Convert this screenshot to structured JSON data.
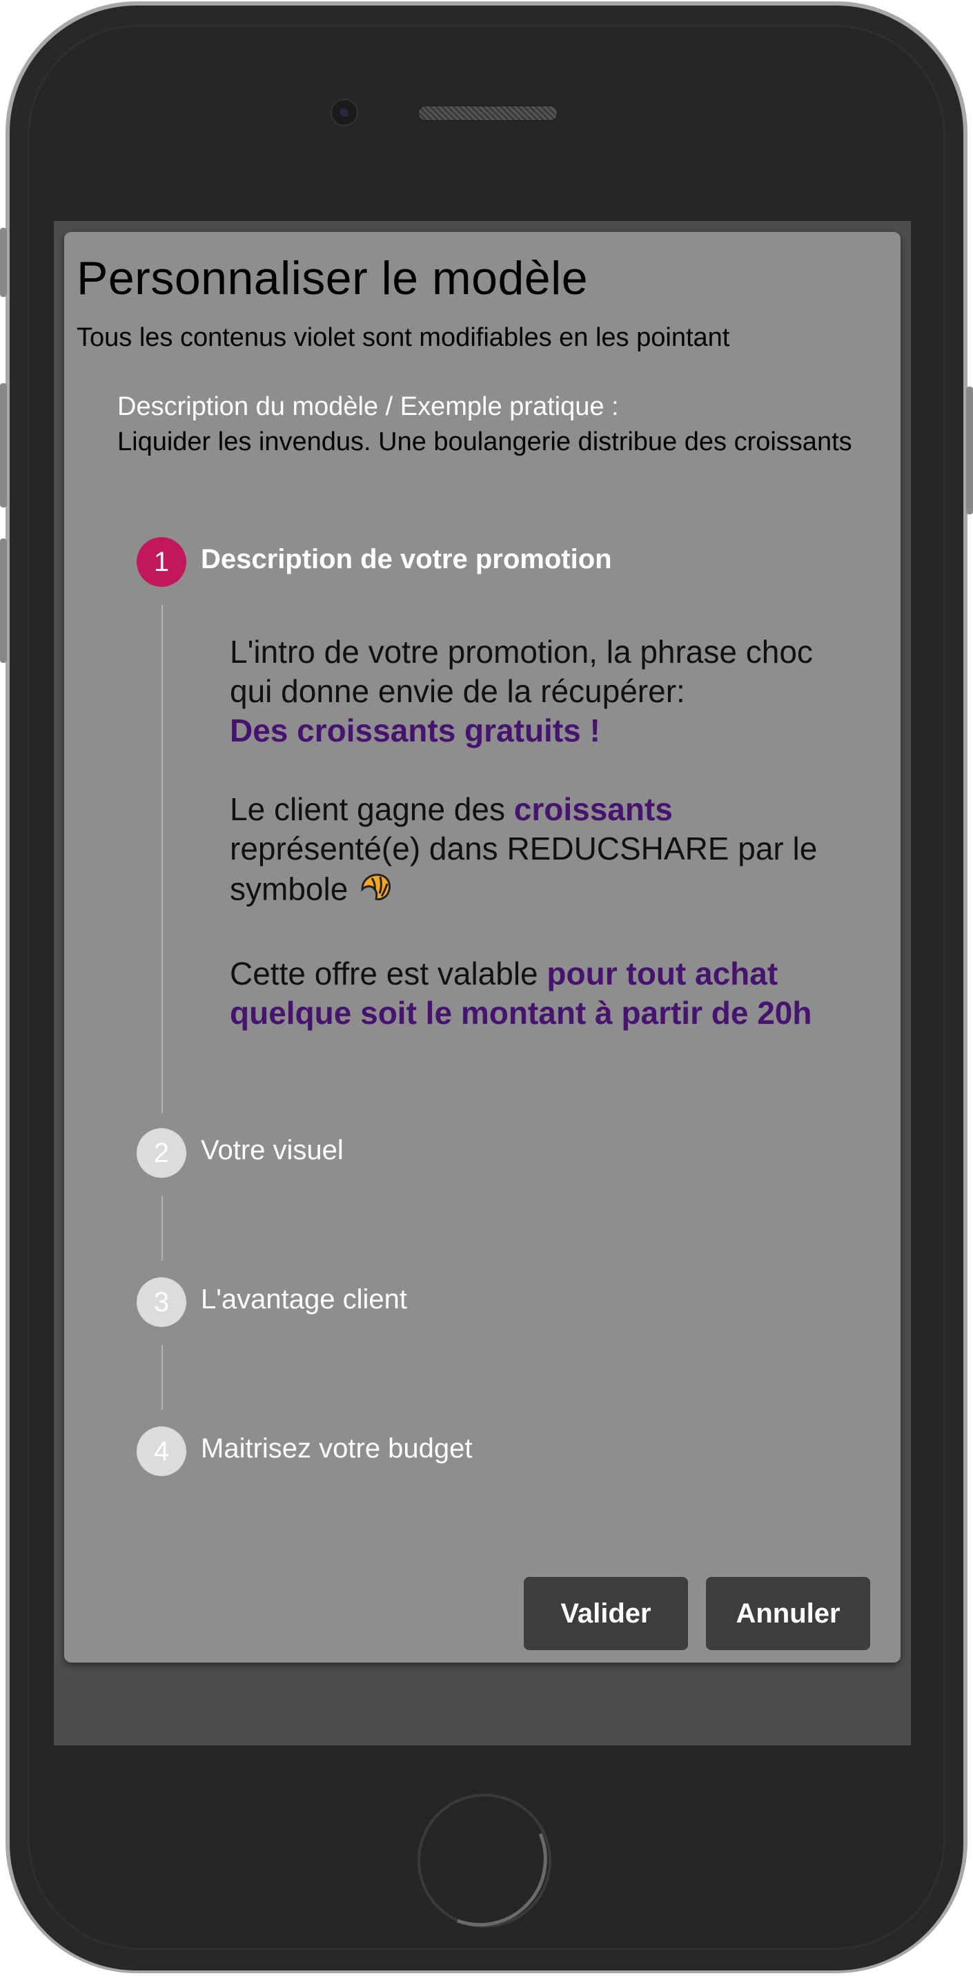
{
  "dialog": {
    "title": "Personnaliser le modèle",
    "subtitle": "Tous les contenus violet sont modifiables en les pointant",
    "description_label": "Description du modèle / Exemple pratique :",
    "description_text": "Liquider les invendus. Une boulangerie distribue des croissants"
  },
  "steps": [
    {
      "number": "1",
      "label": "Description de votre promotion",
      "active": true
    },
    {
      "number": "2",
      "label": "Votre visuel",
      "active": false
    },
    {
      "number": "3",
      "label": "L'avantage client",
      "active": false
    },
    {
      "number": "4",
      "label": "Maitrisez votre budget",
      "active": false
    }
  ],
  "step1_content": {
    "intro_text": "L'intro de votre promotion, la phrase choc qui donne envie de la récupérer:",
    "intro_value": "Des croissants gratuits !",
    "gain_prefix": "Le client gagne des",
    "gain_value": "croissants",
    "gain_suffix": "représenté(e) dans REDUCSHARE par le symbole",
    "symbol_icon": "croissant-emoji",
    "validity_prefix": "Cette offre est valable",
    "validity_value": "pour tout achat quelque soit le montant à partir de 20h"
  },
  "buttons": {
    "validate": "Valider",
    "cancel": "Annuler"
  },
  "colors": {
    "accent_purple": "#46146e",
    "active_step": "#c2185b",
    "inactive_step": "#dcdcdc",
    "dialog_bg": "#8e8e8e",
    "button_bg": "#3d3d3d"
  }
}
